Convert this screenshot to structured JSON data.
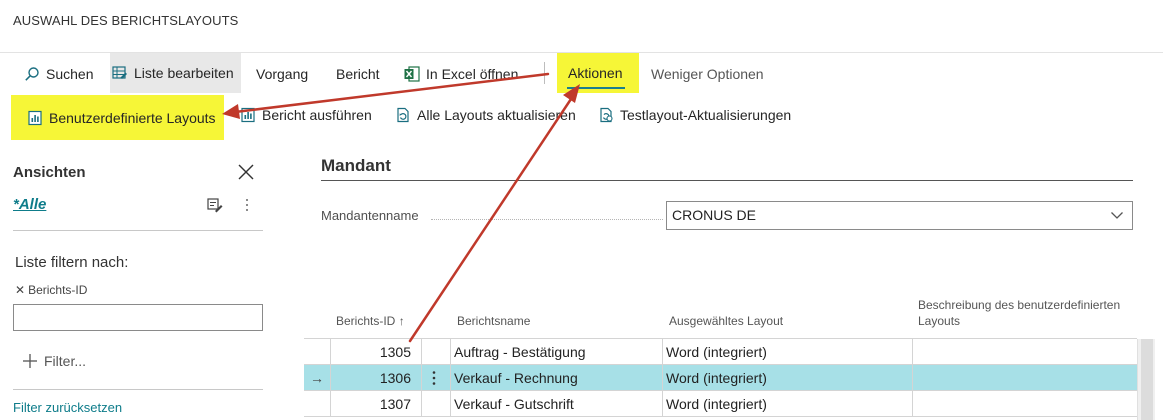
{
  "page": {
    "title": "AUSWAHL DES BERICHTSLAYOUTS"
  },
  "toolbar": {
    "search": "Suchen",
    "edit_list": "Liste bearbeiten",
    "process": "Vorgang",
    "report": "Bericht",
    "open_excel": "In Excel öffnen",
    "actions": "Aktionen",
    "fewer_options": "Weniger Optionen"
  },
  "actions_bar": {
    "custom_layouts": "Benutzerdefinierte Layouts",
    "run_report": "Bericht ausführen",
    "update_all_layouts": "Alle Layouts aktualisieren",
    "test_layout_updates": "Testlayout-Aktualisierungen"
  },
  "sidebar": {
    "title": "Ansichten",
    "view_all": "*Alle",
    "filter_by": "Liste filtern nach:",
    "filter_chip": "Berichts-ID",
    "add_filter": "Filter...",
    "reset_filter": "Filter zurücksetzen"
  },
  "company": {
    "section_title": "Mandant",
    "field_label": "Mandantenname",
    "field_value": "CRONUS DE"
  },
  "table": {
    "columns": {
      "report_id": "Berichts-ID",
      "report_name": "Berichtsname",
      "selected_layout": "Ausgewähltes Layout",
      "custom_desc_line1": "Beschreibung des benutzerdefinierten",
      "custom_desc_line2": "Layouts"
    },
    "sort_indicator": "↑",
    "rows": [
      {
        "id": "1305",
        "name": "Auftrag - Bestätigung",
        "layout": "Word (integriert)",
        "desc": ""
      },
      {
        "id": "1306",
        "name": "Verkauf - Rechnung",
        "layout": "Word (integriert)",
        "desc": ""
      },
      {
        "id": "1307",
        "name": "Verkauf - Gutschrift",
        "layout": "Word (integriert)",
        "desc": ""
      }
    ]
  },
  "colors": {
    "highlight": "#f6f637",
    "accent": "#1a7f8e",
    "selected_row": "#a7e0e7",
    "annotation_arrow": "#c0392b"
  }
}
